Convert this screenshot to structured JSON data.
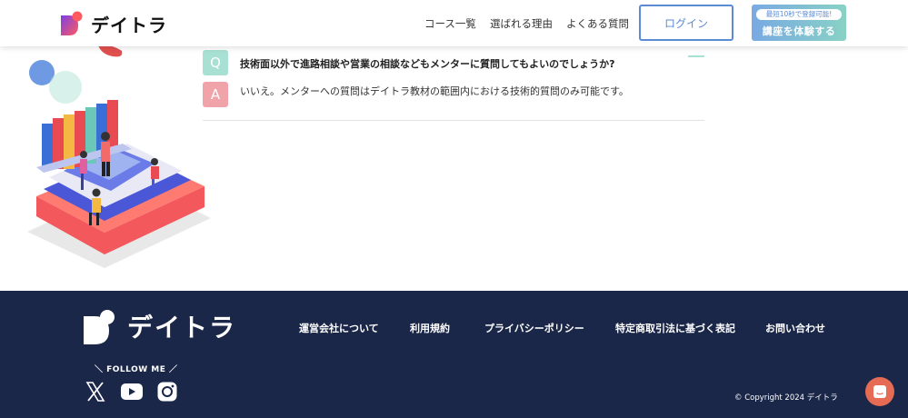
{
  "header": {
    "logo_text": "デイトラ",
    "nav": [
      "コース一覧",
      "選ばれる理由",
      "よくある質問"
    ],
    "login_label": "ログイン",
    "trial_badge": "最短10秒で登録可能!",
    "trial_label": "講座を体験する"
  },
  "faq": {
    "q_mark": "Q",
    "a_mark": "A",
    "question": "技術面以外で進路相談や営業の相談などもメンターに質問してもよいのでしょうか?",
    "answer": "いいえ。メンターへの質問はデイトラ教材の範囲内における技術的質問のみ可能です。"
  },
  "footer": {
    "logo_text": "デイトラ",
    "links": [
      "運営会社について",
      "利用規約",
      "プライバシーポリシー",
      "特定商取引法に基づく表記",
      "お問い合わせ"
    ],
    "follow_label": "＼ FOLLOW ME ／",
    "copyright": "© Copyright 2024 デイトラ"
  },
  "colors": {
    "accent_blue": "#5b8bd6",
    "q_teal": "#a8e0d3",
    "a_pink": "#f0a4aa",
    "footer_navy": "#1b2749",
    "chat_orange": "#e56b55"
  },
  "icons": [
    "x-icon",
    "youtube-icon",
    "instagram-icon",
    "chat-icon"
  ]
}
